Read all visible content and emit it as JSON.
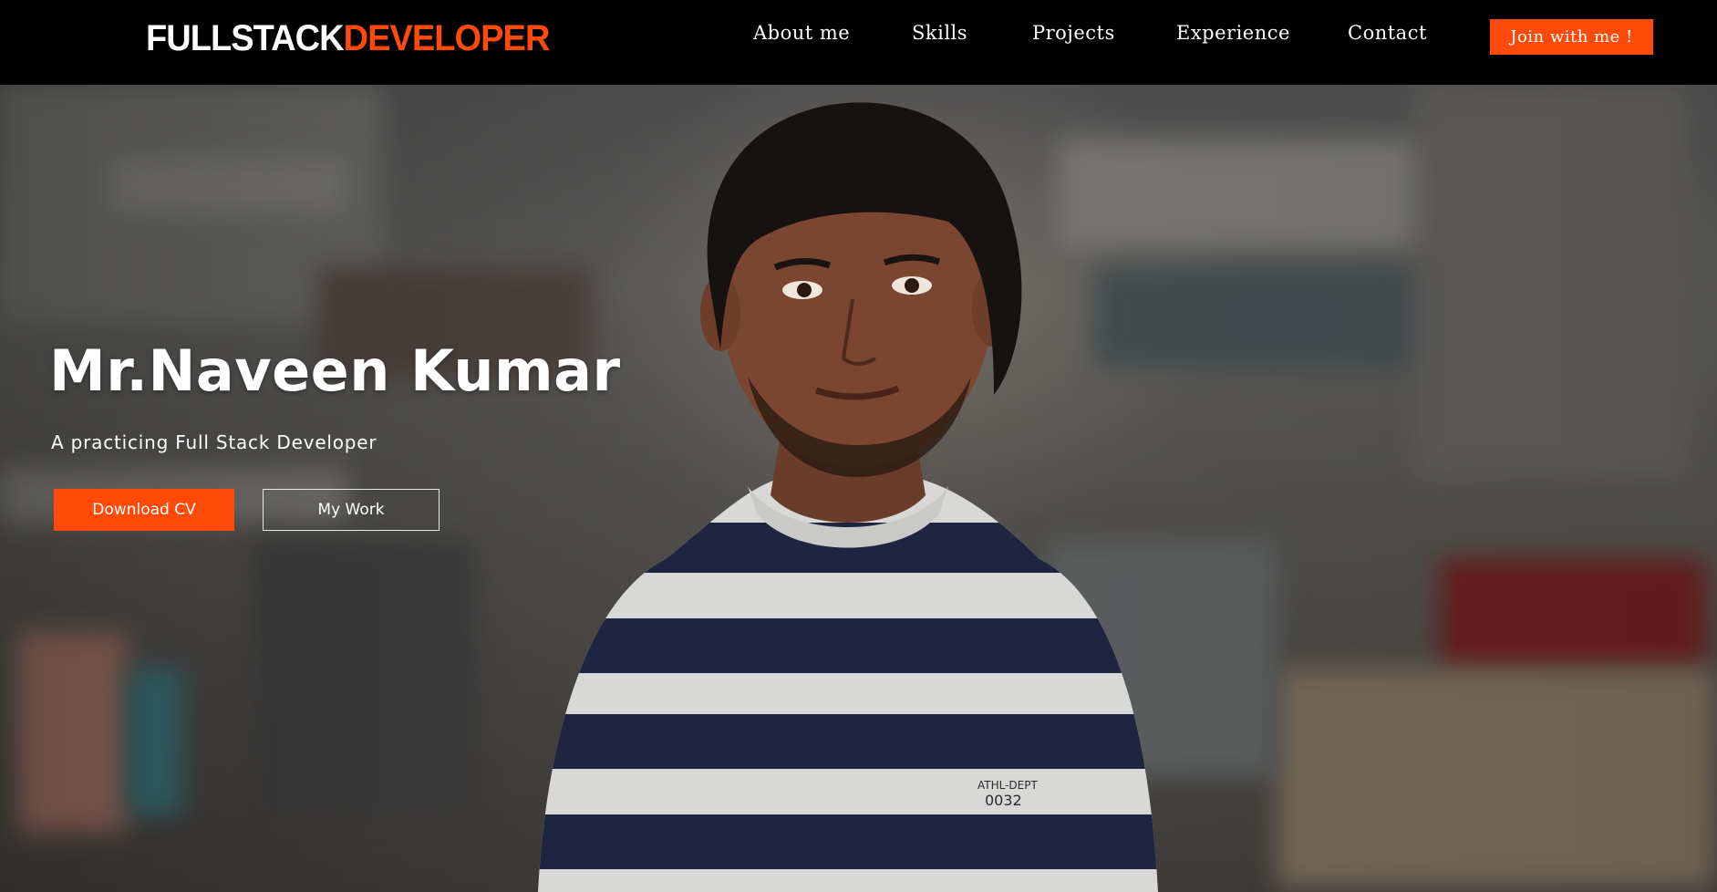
{
  "brand": {
    "logo_part_a": "FULLSTACK",
    "logo_part_b": "DEVELOPER",
    "accent_color": "#ff4a0a"
  },
  "nav": {
    "items": [
      {
        "label": "About me"
      },
      {
        "label": "Skills"
      },
      {
        "label": "Projects"
      },
      {
        "label": "Experience"
      },
      {
        "label": "Contact"
      }
    ],
    "cta_label": "Join with me !"
  },
  "hero": {
    "name": "Mr.Naveen Kumar",
    "subtitle": "A practicing Full Stack Developer",
    "primary_button": "Download CV",
    "secondary_button": "My Work",
    "photo": "portrait-photo"
  },
  "shirt_text": {
    "line1": "ATHL-DEPT",
    "line2": "0032"
  }
}
